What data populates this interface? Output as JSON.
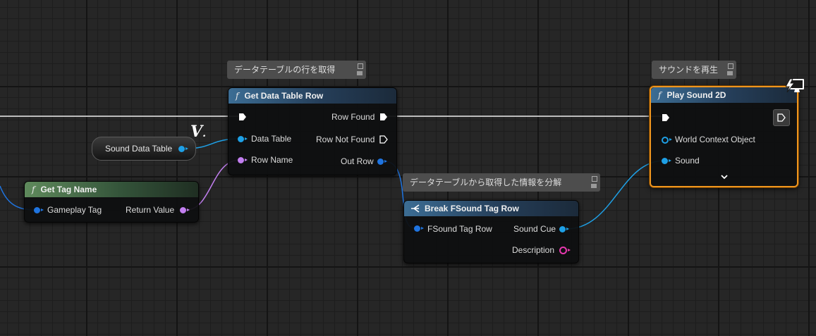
{
  "comments": {
    "get_row": "データテーブルの行を取得",
    "break_row": "データテーブルから取得した情報を分解",
    "play_sound": "サウンドを再生"
  },
  "nodes": {
    "sound_data_table": {
      "label": "Sound Data Table"
    },
    "get_tag_name": {
      "title": "Get Tag Name",
      "input": "Gameplay Tag",
      "output": "Return Value"
    },
    "get_data_table_row": {
      "title": "Get Data Table Row",
      "inputs": [
        "Data Table",
        "Row Name"
      ],
      "outputs": [
        "Row Found",
        "Row Not Found",
        "Out Row"
      ]
    },
    "break_row": {
      "title": "Break FSound Tag Row",
      "input": "FSound Tag Row",
      "outputs": [
        "Sound Cue",
        "Description"
      ]
    },
    "play_sound_2d": {
      "title": "Play Sound 2D",
      "inputs": [
        "World Context Object",
        "Sound"
      ]
    }
  },
  "glyphs": {
    "function": "f"
  },
  "icons": [
    "function-icon",
    "exec-pin-icon",
    "data-pin-icon",
    "break-struct-icon",
    "expand-chevron-icon",
    "variable-watch-icon",
    "client-server-icon"
  ],
  "colors": {
    "exec_wire": "#bdbdbd",
    "object_pin": "#1ea0e6",
    "struct_pin": "#1f74e0",
    "name_pin": "#c27ff0",
    "text_pin": "#e838b0",
    "selection": "#f0961e"
  }
}
